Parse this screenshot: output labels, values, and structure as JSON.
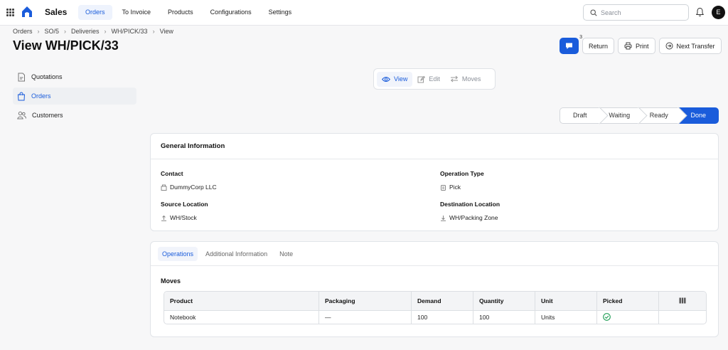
{
  "app": {
    "name": "Sales"
  },
  "nav": {
    "items": [
      "Orders",
      "To Invoice",
      "Products",
      "Configurations",
      "Settings"
    ],
    "active": 0
  },
  "search": {
    "placeholder": "Search"
  },
  "user": {
    "avatar_initial": "E"
  },
  "breadcrumb": [
    "Orders",
    "SO/5",
    "Deliveries",
    "WH/PICK/33",
    "View"
  ],
  "page": {
    "title": "View WH/PICK/33"
  },
  "actions": {
    "messages_count": "3",
    "return_label": "Return",
    "print_label": "Print",
    "next_transfer_label": "Next Transfer"
  },
  "sidebar": {
    "items": [
      {
        "label": "Quotations",
        "icon": "document-icon"
      },
      {
        "label": "Orders",
        "icon": "shopping-bag-icon"
      },
      {
        "label": "Customers",
        "icon": "users-icon"
      }
    ],
    "active": 1
  },
  "view_toggle": {
    "items": [
      {
        "label": "View",
        "icon": "eye-icon"
      },
      {
        "label": "Edit",
        "icon": "edit-icon"
      },
      {
        "label": "Moves",
        "icon": "arrows-icon"
      }
    ],
    "active": 0
  },
  "status": {
    "steps": [
      "Draft",
      "Waiting",
      "Ready",
      "Done"
    ],
    "active": 3
  },
  "general": {
    "title": "General Information",
    "contact_label": "Contact",
    "contact_value": "DummyCorp LLC",
    "operation_type_label": "Operation Type",
    "operation_type_value": "Pick",
    "source_label": "Source Location",
    "source_value": "WH/Stock",
    "destination_label": "Destination Location",
    "destination_value": "WH/Packing Zone"
  },
  "tabs": {
    "items": [
      "Operations",
      "Additional Information",
      "Note"
    ],
    "active": 0
  },
  "moves": {
    "title": "Moves",
    "columns": [
      "Product",
      "Packaging",
      "Demand",
      "Quantity",
      "Unit",
      "Picked"
    ],
    "rows": [
      {
        "product": "Notebook",
        "packaging": "—",
        "demand": "100",
        "quantity": "100",
        "unit": "Units",
        "picked": true
      }
    ]
  },
  "colors": {
    "accent": "#1a5cdb",
    "success": "#1f9d55"
  }
}
